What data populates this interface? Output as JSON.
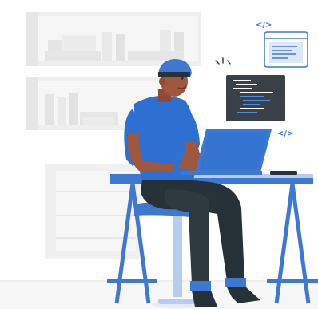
{
  "illustration": {
    "code_tags": [
      "</>",
      "</>",
      "</>"
    ]
  },
  "palette": {
    "accent_blue": "#3F78D0",
    "shirt_blue": "#2E6FD2",
    "light_blue": "#B7CCEE",
    "pants_dark": "#263238",
    "skin_brown": "#A0583C",
    "code_screen": "#3A4148",
    "background_gray": "#F2F2F2"
  },
  "icons": [
    "code-bracket-icon",
    "browser-window-icon",
    "code-editor-window-icon",
    "laptop-icon",
    "sparkle-marks-icon"
  ]
}
